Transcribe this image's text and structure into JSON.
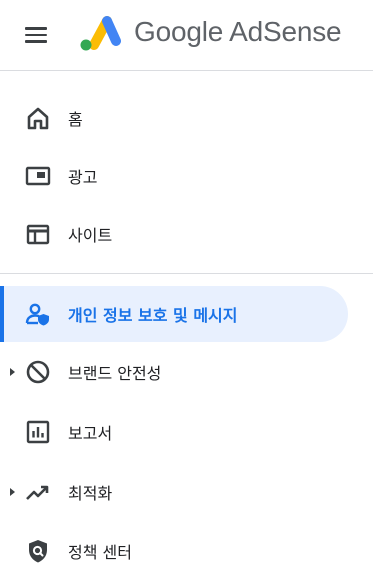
{
  "header": {
    "brand": "Google AdSense",
    "menu_icon": "hamburger-menu-icon",
    "logo_icon": "adsense-logo-icon"
  },
  "nav": {
    "items": [
      {
        "label": "홈",
        "icon": "home-icon"
      },
      {
        "label": "광고",
        "icon": "ads-icon"
      },
      {
        "label": "사이트",
        "icon": "sites-icon"
      },
      {
        "label": "개인 정보 보호 및 메시지",
        "icon": "privacy-messaging-icon",
        "active": true
      },
      {
        "label": "브랜드 안전성",
        "icon": "brand-safety-icon",
        "expandable": true
      },
      {
        "label": "보고서",
        "icon": "reports-icon"
      },
      {
        "label": "최적화",
        "icon": "optimization-icon",
        "expandable": true
      },
      {
        "label": "정책 센터",
        "icon": "policy-center-icon"
      }
    ]
  },
  "colors": {
    "accent": "#1a73e8",
    "active_bg": "#e8f0fe",
    "text": "#202124",
    "icon": "#3c4043",
    "logo_yellow": "#fbbc04",
    "logo_blue": "#4285f4",
    "logo_green": "#34a853"
  }
}
